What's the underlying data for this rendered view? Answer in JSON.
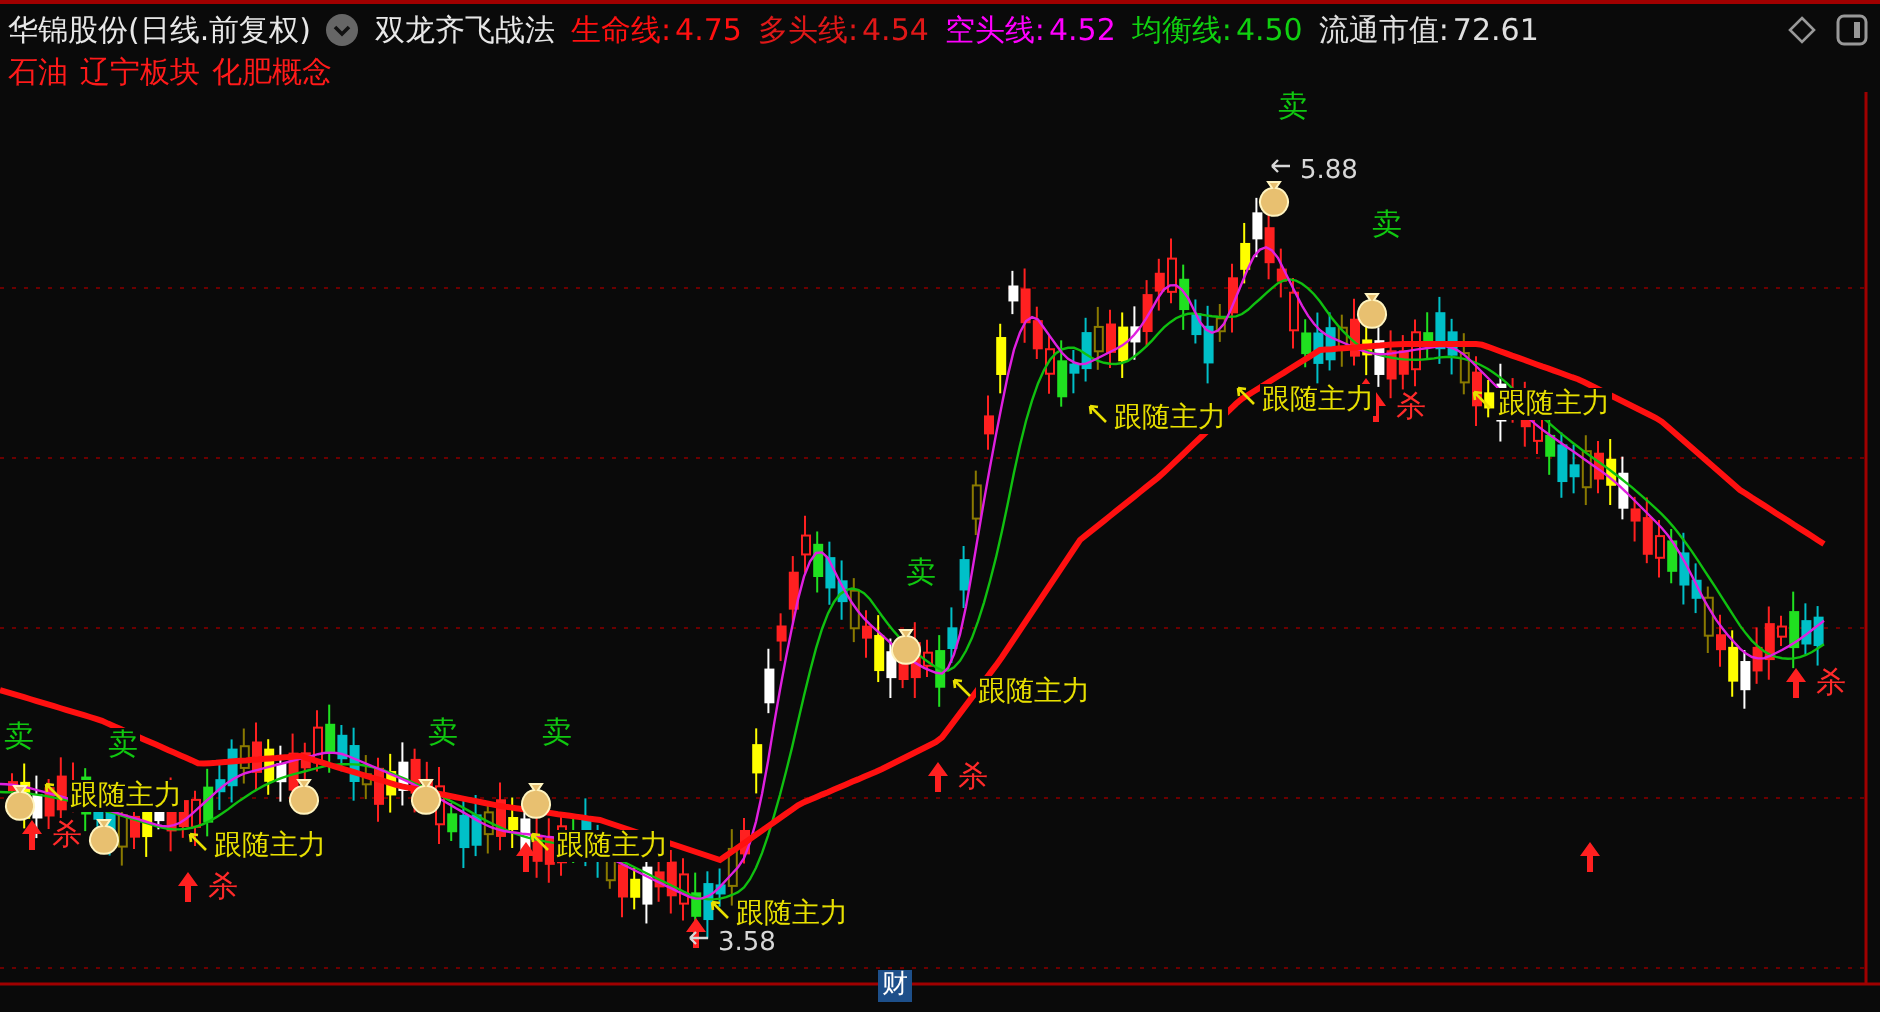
{
  "header": {
    "stock": "华锦股份(日线.前复权)",
    "strategy": "双龙齐飞战法",
    "indicators": [
      {
        "label": "生命线:",
        "value": "4.75",
        "color": "#ff1010"
      },
      {
        "label": "多头线:",
        "value": "4.54",
        "color": "#e01818"
      },
      {
        "label": "空头线:",
        "value": "4.52",
        "color": "#ff00ff"
      },
      {
        "label": "均衡线:",
        "value": "4.50",
        "color": "#10d010"
      }
    ],
    "market_value": {
      "label": "流通市值:",
      "value": "72.61"
    }
  },
  "tags": [
    "石油",
    "辽宁板块",
    "化肥概念"
  ],
  "chart": {
    "signals": [
      {
        "kind": "sell",
        "text": "卖"
      },
      {
        "kind": "sell",
        "text": "卖"
      },
      {
        "kind": "sell",
        "text": "卖"
      },
      {
        "kind": "sell",
        "text": "卖"
      },
      {
        "kind": "sell",
        "text": "卖"
      },
      {
        "kind": "sell",
        "text": "卖"
      },
      {
        "kind": "sell",
        "text": "卖"
      },
      {
        "kind": "follow",
        "text": "跟随主力"
      },
      {
        "kind": "follow",
        "text": "跟随主力"
      },
      {
        "kind": "follow",
        "text": "跟随主力"
      },
      {
        "kind": "follow",
        "text": "跟随主力"
      },
      {
        "kind": "follow",
        "text": "跟随主力"
      },
      {
        "kind": "follow",
        "text": "跟随主力"
      },
      {
        "kind": "follow",
        "text": "跟随主力"
      },
      {
        "kind": "follow",
        "text": "跟随主力"
      },
      {
        "kind": "kill",
        "text": "杀"
      },
      {
        "kind": "kill",
        "text": "杀"
      },
      {
        "kind": "kill",
        "text": "杀"
      },
      {
        "kind": "kill",
        "text": "杀"
      },
      {
        "kind": "kill",
        "text": "杀"
      },
      {
        "kind": "high",
        "text": "5.88"
      },
      {
        "kind": "low",
        "text": "3.58"
      }
    ],
    "badge": "财"
  }
}
